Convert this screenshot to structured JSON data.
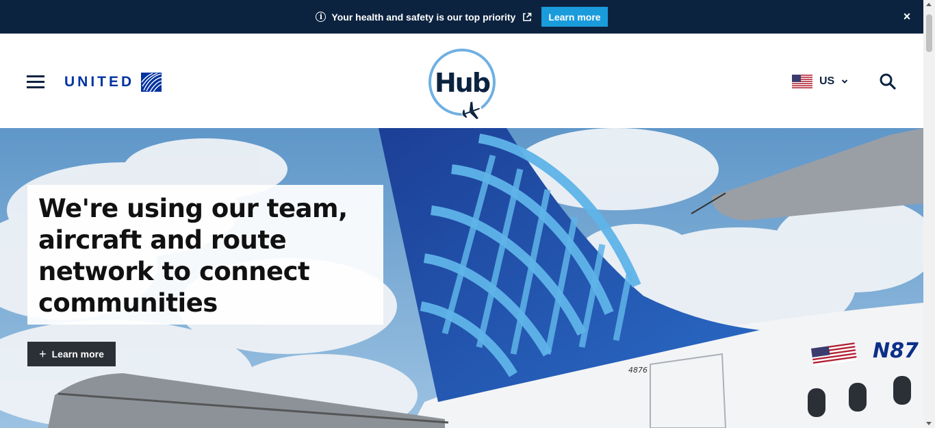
{
  "alert": {
    "message": "Your health and safety is our top priority",
    "cta_label": "Learn more",
    "close_glyph": "×",
    "background": "#0c2340",
    "cta_color": "#1a9bdc"
  },
  "header": {
    "brand_name": "UNITED",
    "hub_logo_text": "Hub",
    "locale_label": "US",
    "icons": [
      "hamburger-menu-icon",
      "globe-icon",
      "plane-icon",
      "us-flag-icon",
      "chevron-down-icon",
      "search-icon"
    ]
  },
  "hero": {
    "heading": "We're using our team, aircraft and route network to connect communities",
    "cta_plus": "+",
    "cta_label": "Learn more",
    "tail_number": "N87",
    "fuselage_number": "4876"
  },
  "colors": {
    "navy": "#0c2340",
    "brand_blue": "#0033a0",
    "sky": "#5f97c9",
    "button_dark": "#2b3037"
  }
}
